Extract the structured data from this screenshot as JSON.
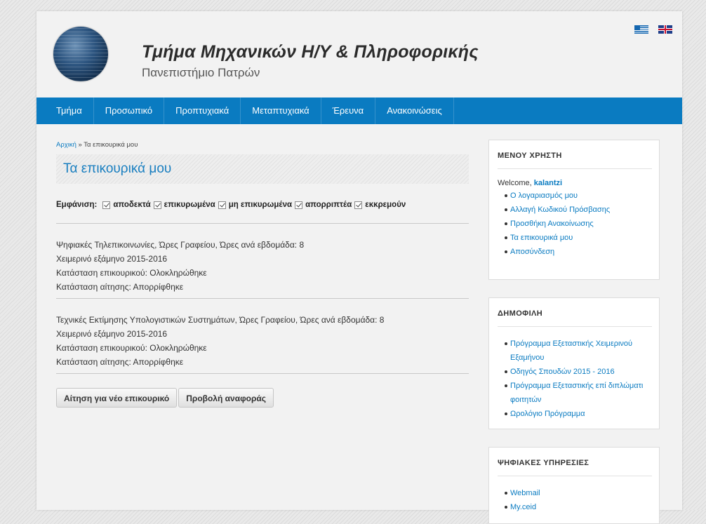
{
  "header": {
    "title": "Τμήμα Μηχανικών Η/Υ & Πληροφορικής",
    "subtitle": "Πανεπιστήμιο Πατρών"
  },
  "nav": [
    {
      "label": "Τμήμα"
    },
    {
      "label": "Προσωπικό"
    },
    {
      "label": "Προπτυχιακά"
    },
    {
      "label": "Μεταπτυχιακά"
    },
    {
      "label": "Έρευνα"
    },
    {
      "label": "Ανακοινώσεις"
    }
  ],
  "breadcrumb": {
    "home": "Αρχική",
    "separator": " » ",
    "current": "Τα επικουρικά μου"
  },
  "page_title": "Τα επικουρικά μου",
  "filters": {
    "label": "Εμφάνιση:",
    "options": [
      "αποδεκτά",
      "επικυρωμένα",
      "μη επικυρωμένα",
      "απορριπτέα",
      "εκκρεμούν"
    ]
  },
  "entries": [
    {
      "course": "Ψηφιακές Τηλεπικοινωνίες, Ώρες Γραφείου, Ώρες ανά εβδομάδα: 8",
      "semester": "Χειμερινό εξάμηνο 2015-2016",
      "status": "Κατάσταση επικουρικού: Ολοκληρώθηκε",
      "application": "Κατάσταση αίτησης: Απορρίφθηκε"
    },
    {
      "course": "Τεχνικές Εκτίμησης Υπολογιστικών Συστημάτων, Ώρες Γραφείου, Ώρες ανά εβδομάδα: 8",
      "semester": "Χειμερινό εξάμηνο 2015-2016",
      "status": "Κατάσταση επικουρικού: Ολοκληρώθηκε",
      "application": "Κατάσταση αίτησης: Απορρίφθηκε"
    }
  ],
  "buttons": {
    "new": "Αίτηση για νέο επικουρικό",
    "report": "Προβολή αναφοράς"
  },
  "user_menu": {
    "title": "ΜΕΝΟΥ ΧΡΗΣΤΗ",
    "welcome": "Welcome,",
    "username": "kalantzi",
    "items": [
      "Ο λογαριασμός μου",
      "Αλλαγή Κωδικού Πρόσβασης",
      "Προσθήκη Ανακοίνωσης",
      "Τα επικουρικά μου",
      "Αποσύνδεση"
    ]
  },
  "popular": {
    "title": "ΔΗΜΟΦΙΛΗ",
    "items": [
      "Πρόγραμμα Εξεταστικής Χειμερινού Εξαμήνου",
      "Οδηγός Σπουδών 2015 - 2016",
      "Πρόγραμμα Εξεταστικής επί διπλώματι φοιτητών",
      "Ωρολόγιο Πρόγραμμα"
    ]
  },
  "services": {
    "title": "ΨΗΦΙΑΚΕΣ ΥΠΗΡΕΣΙΕΣ",
    "items": [
      "Webmail",
      "My.ceid"
    ]
  },
  "colors": {
    "accent": "#0a7bc1",
    "title_blue": "#1a7fc0"
  }
}
